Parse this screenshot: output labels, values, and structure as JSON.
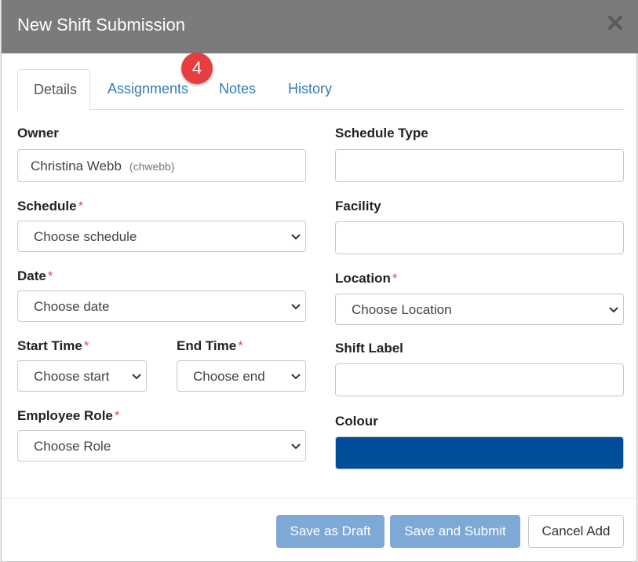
{
  "modal": {
    "title": "New Shift Submission",
    "close_icon": "close-icon"
  },
  "tabs": [
    {
      "label": "Details",
      "active": true
    },
    {
      "label": "Assignments",
      "active": false,
      "badge": "4"
    },
    {
      "label": "Notes",
      "active": false
    },
    {
      "label": "History",
      "active": false
    }
  ],
  "form": {
    "owner": {
      "label": "Owner",
      "value": "Christina Webb",
      "username": "(chwebb)"
    },
    "schedule": {
      "label": "Schedule",
      "required": "*",
      "placeholder": "Choose schedule"
    },
    "date": {
      "label": "Date",
      "required": "*",
      "placeholder": "Choose date"
    },
    "start_time": {
      "label": "Start Time",
      "required": "*",
      "placeholder": "Choose start"
    },
    "end_time": {
      "label": "End Time",
      "required": "*",
      "placeholder": "Choose end"
    },
    "employee_role": {
      "label": "Employee Role",
      "required": "*",
      "placeholder": "Choose Role"
    },
    "schedule_type": {
      "label": "Schedule Type",
      "value": ""
    },
    "facility": {
      "label": "Facility",
      "value": ""
    },
    "location": {
      "label": "Location",
      "required": "*",
      "placeholder": "Choose Location"
    },
    "shift_label": {
      "label": "Shift Label",
      "value": ""
    },
    "colour": {
      "label": "Colour",
      "value": "#004d9a"
    }
  },
  "footer": {
    "save_draft": "Save as Draft",
    "save_submit": "Save and Submit",
    "cancel": "Cancel Add"
  },
  "colors": {
    "header": "#7b7b7b",
    "link": "#337ab7",
    "badge": "#e63e3e",
    "required": "#d9534f",
    "primary_disabled": "#7ea8d6"
  }
}
